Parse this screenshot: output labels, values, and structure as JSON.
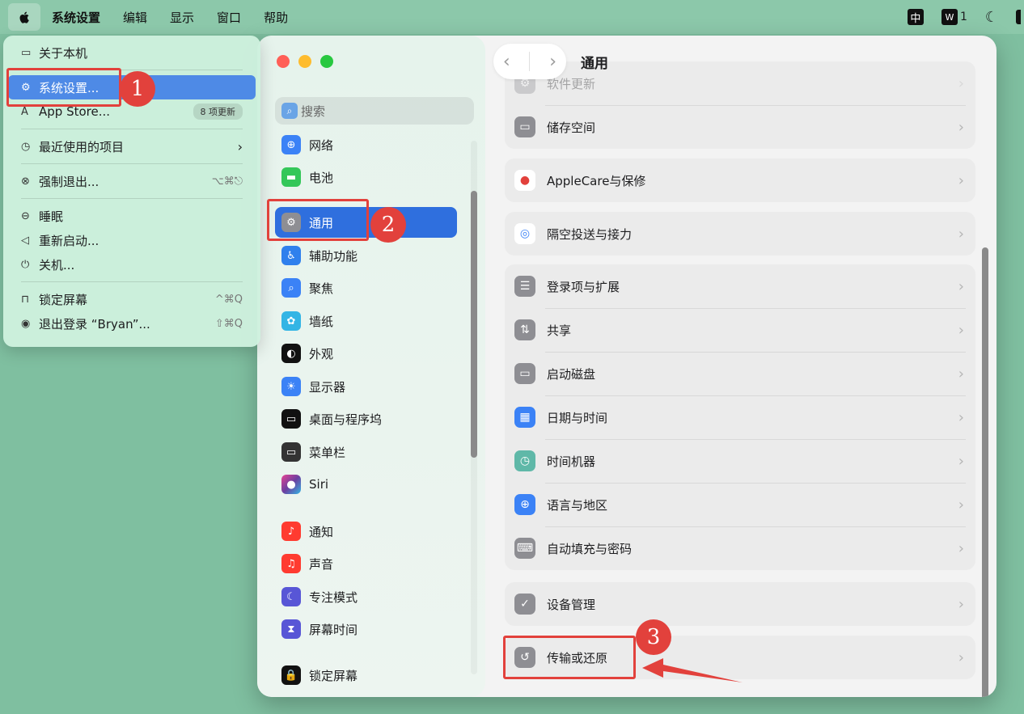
{
  "menubar": {
    "apple_icon": "apple-logo-icon",
    "items": [
      "系统设置",
      "编辑",
      "显示",
      "窗口",
      "帮助"
    ],
    "right": {
      "input_method": "中",
      "wps_count": "1"
    }
  },
  "apple_menu": {
    "about": "关于本机",
    "settings": "系统设置...",
    "appstore": "App Store...",
    "appstore_badge": "8 项更新",
    "recent": "最近使用的项目",
    "force_quit": "强制退出...",
    "force_quit_sc": "⌥⌘⎋",
    "sleep": "睡眠",
    "restart": "重新启动...",
    "shutdown": "关机...",
    "lock": "锁定屏幕",
    "lock_sc": "^⌘Q",
    "logout": "退出登录 “Bryan”...",
    "logout_sc": "⇧⌘Q"
  },
  "sidebar": {
    "search_placeholder": "搜索",
    "items": [
      {
        "label": "网络",
        "icon": "globe-icon",
        "color": "#3b82f6"
      },
      {
        "label": "电池",
        "icon": "battery-icon",
        "color": "#34c759"
      },
      {
        "label": "通用",
        "icon": "gear-icon",
        "color": "#8e8e93"
      },
      {
        "label": "辅助功能",
        "icon": "accessibility-icon",
        "color": "#2f80ed"
      },
      {
        "label": "聚焦",
        "icon": "magnifier-icon",
        "color": "#3b82f6"
      },
      {
        "label": "墙纸",
        "icon": "flower-icon",
        "color": "#33b5e5"
      },
      {
        "label": "外观",
        "icon": "appearance-icon",
        "color": "#111111"
      },
      {
        "label": "显示器",
        "icon": "sun-icon",
        "color": "#3b82f6"
      },
      {
        "label": "桌面与程序坞",
        "icon": "dock-icon",
        "color": "#111111"
      },
      {
        "label": "菜单栏",
        "icon": "menubar-icon",
        "color": "#333333"
      },
      {
        "label": "Siri",
        "icon": "siri-icon",
        "color": "#6b3fa0"
      },
      {
        "label": "通知",
        "icon": "bell-icon",
        "color": "#ff3b30"
      },
      {
        "label": "声音",
        "icon": "speaker-icon",
        "color": "#ff3b30"
      },
      {
        "label": "专注模式",
        "icon": "moon-icon",
        "color": "#5856d6"
      },
      {
        "label": "屏幕时间",
        "icon": "hourglass-icon",
        "color": "#5856d6"
      },
      {
        "label": "锁定屏幕",
        "icon": "lock-icon",
        "color": "#111111"
      }
    ]
  },
  "main": {
    "title": "通用",
    "groups": [
      {
        "rows": [
          {
            "label": "软件更新",
            "icon": "gear-icon"
          },
          {
            "label": "储存空间",
            "icon": "disk-icon"
          }
        ]
      },
      {
        "rows": [
          {
            "label": "AppleCare与保修",
            "icon": "apple-icon"
          }
        ]
      },
      {
        "rows": [
          {
            "label": "隔空投送与接力",
            "icon": "airdrop-icon"
          }
        ]
      },
      {
        "rows": [
          {
            "label": "登录项与扩展",
            "icon": "list-icon"
          },
          {
            "label": "共享",
            "icon": "share-icon"
          },
          {
            "label": "启动磁盘",
            "icon": "disk-icon"
          },
          {
            "label": "日期与时间",
            "icon": "calendar-icon"
          },
          {
            "label": "时间机器",
            "icon": "timemachine-icon"
          },
          {
            "label": "语言与地区",
            "icon": "globe-icon"
          },
          {
            "label": "自动填充与密码",
            "icon": "key-icon"
          }
        ]
      },
      {
        "rows": [
          {
            "label": "设备管理",
            "icon": "shield-check-icon"
          }
        ]
      },
      {
        "rows": [
          {
            "label": "传输或还原",
            "icon": "restore-icon"
          }
        ]
      }
    ]
  },
  "annotations": [
    "1",
    "2",
    "3"
  ],
  "colors": {
    "highlight": "#e2413c",
    "selection": "#2f6fde",
    "menu_selection": "#4e8ae6"
  }
}
